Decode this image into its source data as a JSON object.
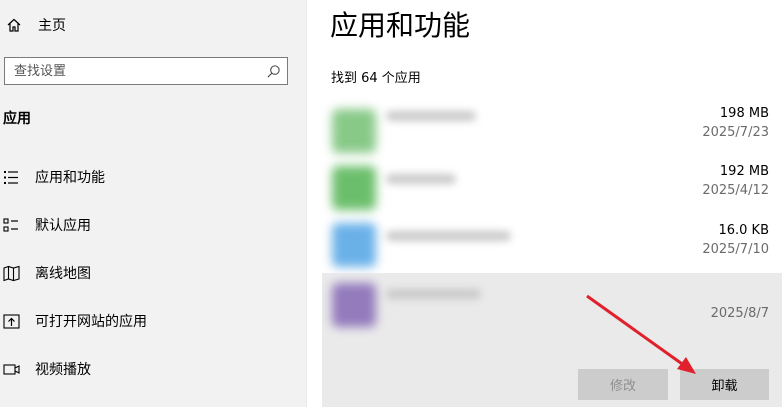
{
  "sidebar": {
    "home_label": "主页",
    "search_placeholder": "查找设置",
    "section_title": "应用",
    "items": [
      {
        "label": "应用和功能",
        "icon": "apps-list-icon"
      },
      {
        "label": "默认应用",
        "icon": "default-apps-icon"
      },
      {
        "label": "离线地图",
        "icon": "map-icon"
      },
      {
        "label": "可打开网站的应用",
        "icon": "open-web-icon"
      },
      {
        "label": "视频播放",
        "icon": "video-icon"
      }
    ]
  },
  "main": {
    "title": "应用和功能",
    "found_text": "找到 64 个应用",
    "apps": [
      {
        "size": "198 MB",
        "date": "2025/7/23",
        "icon_color": "#7cc47c"
      },
      {
        "size": "192 MB",
        "date": "2025/4/12",
        "icon_color": "#5cb85c"
      },
      {
        "size": "16.0 KB",
        "date": "2025/7/10",
        "icon_color": "#5aa9e6"
      },
      {
        "size": "",
        "date": "2025/8/7",
        "icon_color": "#8a6fb8",
        "selected": true
      }
    ],
    "buttons": {
      "modify": "修改",
      "uninstall": "卸载"
    }
  },
  "colors": {
    "accent_arrow": "#e0202b",
    "sidebar_bg": "#f2f2f2",
    "selected_row": "#eaeaea"
  }
}
